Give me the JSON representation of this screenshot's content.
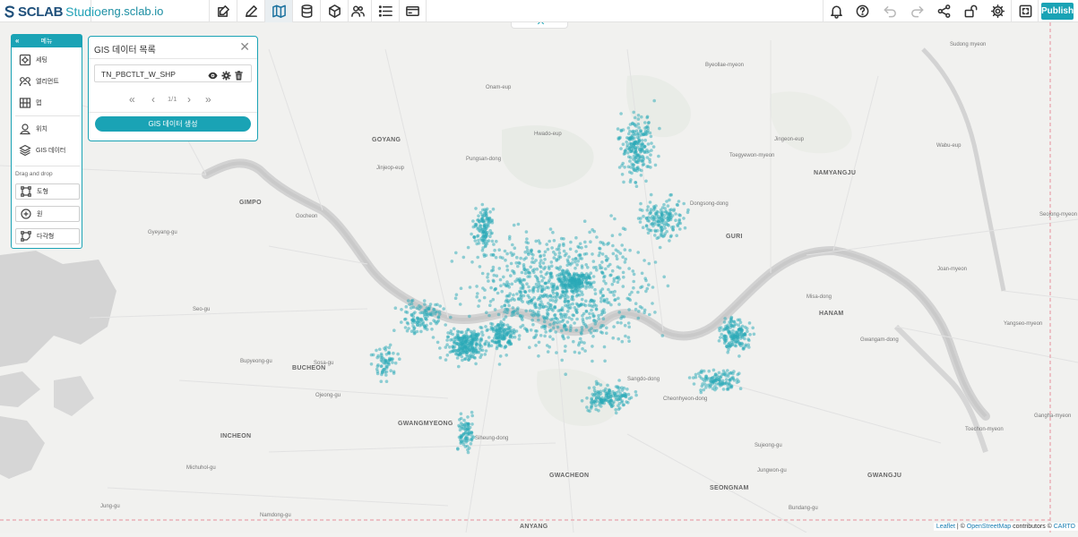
{
  "app": {
    "brand": "SCLAB",
    "product": "Studio",
    "domain": "eng.sclab.io",
    "publish_label": "Publish"
  },
  "toolbar": {
    "left_tools": [
      {
        "name": "edit-note",
        "icon": "edit-note-icon"
      },
      {
        "name": "edit",
        "icon": "pencil-icon"
      },
      {
        "name": "map",
        "icon": "map-icon",
        "active": true
      },
      {
        "name": "database",
        "icon": "database-icon"
      },
      {
        "name": "cube",
        "icon": "cube-icon"
      },
      {
        "name": "users",
        "icon": "users-icon"
      },
      {
        "name": "list",
        "icon": "list-icon"
      },
      {
        "name": "card",
        "icon": "card-icon"
      }
    ],
    "right_tools": [
      {
        "name": "notifications",
        "icon": "bell-icon"
      },
      {
        "name": "help",
        "icon": "help-icon"
      },
      {
        "name": "undo",
        "icon": "undo-icon",
        "disabled": true
      },
      {
        "name": "redo",
        "icon": "redo-icon",
        "disabled": true
      },
      {
        "name": "share",
        "icon": "share-icon"
      },
      {
        "name": "unlock",
        "icon": "unlock-icon"
      },
      {
        "name": "settings",
        "icon": "gear-icon"
      },
      {
        "name": "fullscreen",
        "icon": "fullscreen-icon"
      }
    ]
  },
  "left_menu": {
    "header": "메뉴",
    "items": [
      {
        "label": "세팅",
        "icon": "settings-icon"
      },
      {
        "label": "엘리먼트",
        "icon": "elements-icon"
      },
      {
        "label": "맵",
        "icon": "grid-map-icon"
      },
      {
        "label": "위치",
        "icon": "location-icon"
      },
      {
        "label": "GIS 데이터",
        "icon": "layers-icon"
      }
    ],
    "drag_drop_label": "Drag and drop",
    "drag_items": [
      {
        "label": "도형",
        "icon": "shape-icon"
      },
      {
        "label": "원",
        "icon": "circle-plus-icon"
      },
      {
        "label": "다각형",
        "icon": "polygon-icon"
      }
    ]
  },
  "gis_panel": {
    "title": "GIS 데이터 목록",
    "layer_name": "TN_PBCTLT_W_SHP",
    "pagination": "1/1",
    "create_button": "GIS 데이터 생성"
  },
  "map": {
    "attribution": {
      "leaflet": "Leaflet",
      "sep": " | © ",
      "osm": "OpenStreetMap",
      "mid": " contributors © ",
      "carto": "CARTO"
    },
    "point_color": "#2aaab8",
    "labels": [
      {
        "text": "GOYANG",
        "big": true
      },
      {
        "text": "GIMPO",
        "big": true
      },
      {
        "text": "BUCHEON",
        "big": true
      },
      {
        "text": "INCHEON",
        "big": true
      },
      {
        "text": "GWANGMYEONG",
        "big": true
      },
      {
        "text": "GURI",
        "big": true
      },
      {
        "text": "NAMYANGJU",
        "big": true
      },
      {
        "text": "HANAM",
        "big": true
      },
      {
        "text": "SEONGNAM",
        "big": true
      },
      {
        "text": "GWACHEON",
        "big": true
      },
      {
        "text": "ANYANG",
        "big": true
      },
      {
        "text": "GWANGJU",
        "big": true
      },
      {
        "text": "Sudong myeon"
      },
      {
        "text": "Byeollae-myeon"
      },
      {
        "text": "Jingeon-eup"
      },
      {
        "text": "Toegyewon-myeon"
      },
      {
        "text": "Wabu-eup"
      },
      {
        "text": "Joan-myeon"
      },
      {
        "text": "Seojong-myeon"
      },
      {
        "text": "Yangseo-myeon"
      },
      {
        "text": "Toechon-myeon"
      },
      {
        "text": "Gangha-myeon"
      },
      {
        "text": "Gyeyang-gu"
      },
      {
        "text": "Bupyeong-gu"
      },
      {
        "text": "Seo-gu"
      },
      {
        "text": "Namdong-gu"
      },
      {
        "text": "Jung-gu"
      },
      {
        "text": "Michuhol-gu"
      },
      {
        "text": "Sosa-gu"
      },
      {
        "text": "Ojeong-gu"
      },
      {
        "text": "Gocheon"
      },
      {
        "text": "Jinjeop-eup"
      },
      {
        "text": "Onam-eup"
      },
      {
        "text": "Hwado-eup"
      },
      {
        "text": "Sujeong-gu"
      },
      {
        "text": "Jungwon-gu"
      },
      {
        "text": "Bundang-gu"
      },
      {
        "text": "Siheung-dong"
      },
      {
        "text": "Cheonhyeon-dong"
      },
      {
        "text": "Misa-dong"
      },
      {
        "text": "Gwangam-dong"
      },
      {
        "text": "Pungsan-dong"
      },
      {
        "text": "Dongsong-dong"
      },
      {
        "text": "Sangdo-dong"
      }
    ]
  }
}
